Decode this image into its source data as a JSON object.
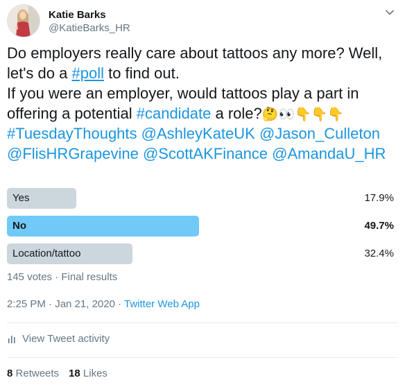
{
  "user": {
    "name": "Katie Barks",
    "handle": "@KatieBarks_HR"
  },
  "tweet": {
    "t1": "Do employers really care about tattoos any more? Well, let's do a ",
    "poll_tag": "#poll",
    "t2": " to find out.",
    "t3": "If you were an employer, would tattoos play a part in offering a potential ",
    "candidate_tag": "#candidate",
    "t4": " a role?",
    "emoji": "🤔👀👇👇👇",
    "tuesday_tag": "#TuesdayThoughts",
    "m1": "@AshleyKateUK",
    "m2": "@Jason_Culleton",
    "m3": "@FlisHRGrapevine",
    "m4": "@ScottAKFinance",
    "m5": "@AmandaU_HR"
  },
  "poll": {
    "options": [
      {
        "label": "Yes",
        "pct_text": "17.9%",
        "value": 17.9,
        "winner": false
      },
      {
        "label": "No",
        "pct_text": "49.7%",
        "value": 49.7,
        "winner": true
      },
      {
        "label": "Location/tattoo",
        "pct_text": "32.4%",
        "value": 32.4,
        "winner": false
      }
    ],
    "meta": "145 votes · Final results"
  },
  "timestamp": {
    "time": "2:25 PM · Jan 21, 2020 · ",
    "app": "Twitter Web App"
  },
  "activity_label": "View Tweet activity",
  "stats": {
    "retweets_count": "8",
    "retweets_label": "Retweets",
    "likes_count": "18",
    "likes_label": "Likes"
  },
  "colors": {
    "link": "#1b95e0",
    "poll_bar": "#ccd6dd",
    "poll_bar_winner": "#71c9f8",
    "muted": "#657786"
  },
  "icons": [
    "chevron-down-icon",
    "activity-bars-icon"
  ]
}
